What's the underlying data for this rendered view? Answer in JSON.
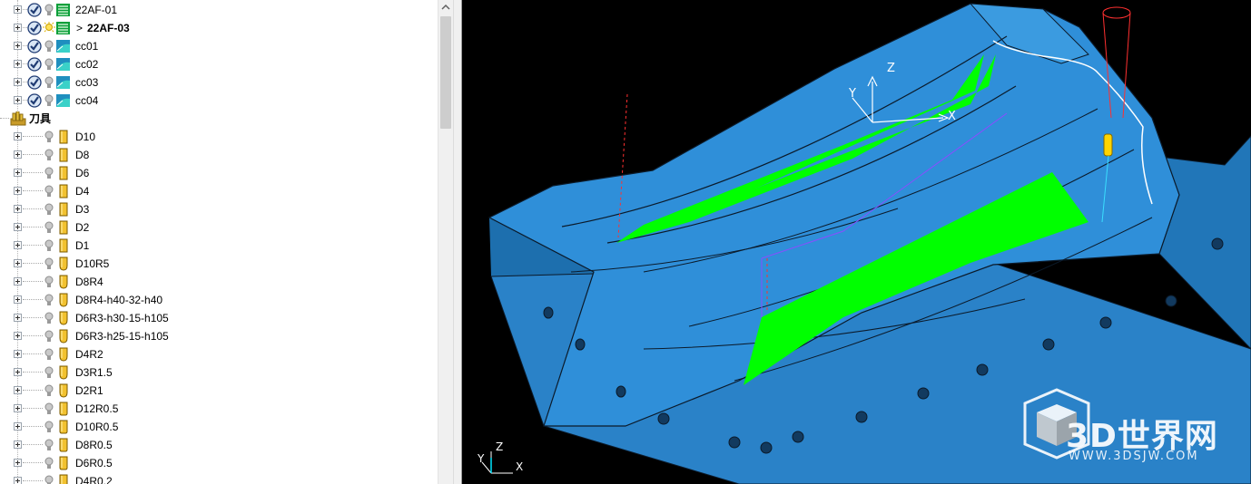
{
  "tree": {
    "toolpaths": [
      {
        "label": "22AF-01",
        "checked": true,
        "active": false,
        "kind": "area"
      },
      {
        "label": "22AF-03",
        "checked": true,
        "active": true,
        "kind": "area",
        "prefix": ">"
      },
      {
        "label": "cc01",
        "checked": true,
        "active": false,
        "kind": "finish"
      },
      {
        "label": "cc02",
        "checked": true,
        "active": false,
        "kind": "finish"
      },
      {
        "label": "cc03",
        "checked": true,
        "active": false,
        "kind": "finish"
      },
      {
        "label": "cc04",
        "checked": true,
        "active": false,
        "kind": "finish"
      }
    ],
    "tools_folder": {
      "label": "刀具"
    },
    "tools": [
      {
        "label": "D10",
        "shape": "flat"
      },
      {
        "label": "D8",
        "shape": "flat"
      },
      {
        "label": "D6",
        "shape": "flat"
      },
      {
        "label": "D4",
        "shape": "flat"
      },
      {
        "label": "D3",
        "shape": "flat"
      },
      {
        "label": "D2",
        "shape": "flat"
      },
      {
        "label": "D1",
        "shape": "flat"
      },
      {
        "label": "D10R5",
        "shape": "ball"
      },
      {
        "label": "D8R4",
        "shape": "ball"
      },
      {
        "label": "D8R4-h40-32-h40",
        "shape": "ball"
      },
      {
        "label": "D6R3-h30-15-h105",
        "shape": "ball"
      },
      {
        "label": "D6R3-h25-15-h105",
        "shape": "ball"
      },
      {
        "label": "D4R2",
        "shape": "ball"
      },
      {
        "label": "D3R1.5",
        "shape": "ball"
      },
      {
        "label": "D2R1",
        "shape": "ball"
      },
      {
        "label": "D12R0.5",
        "shape": "tip"
      },
      {
        "label": "D10R0.5",
        "shape": "tip"
      },
      {
        "label": "D8R0.5",
        "shape": "tip"
      },
      {
        "label": "D6R0.5",
        "shape": "tip"
      },
      {
        "label": "D4R0.2",
        "shape": "tip"
      }
    ]
  },
  "viewport": {
    "workplane_axes": {
      "x": "X",
      "y": "Y",
      "z": "Z"
    },
    "view_triad": {
      "x": "X",
      "y": "Y",
      "z": "Z"
    },
    "watermark": {
      "text": "3D世界网",
      "url": "WWW.3DSJW.COM"
    },
    "colors": {
      "background": "#000000",
      "part": "#2f8fd9",
      "toolpath": "#00ff00",
      "edges": "#0b1a2a"
    }
  }
}
